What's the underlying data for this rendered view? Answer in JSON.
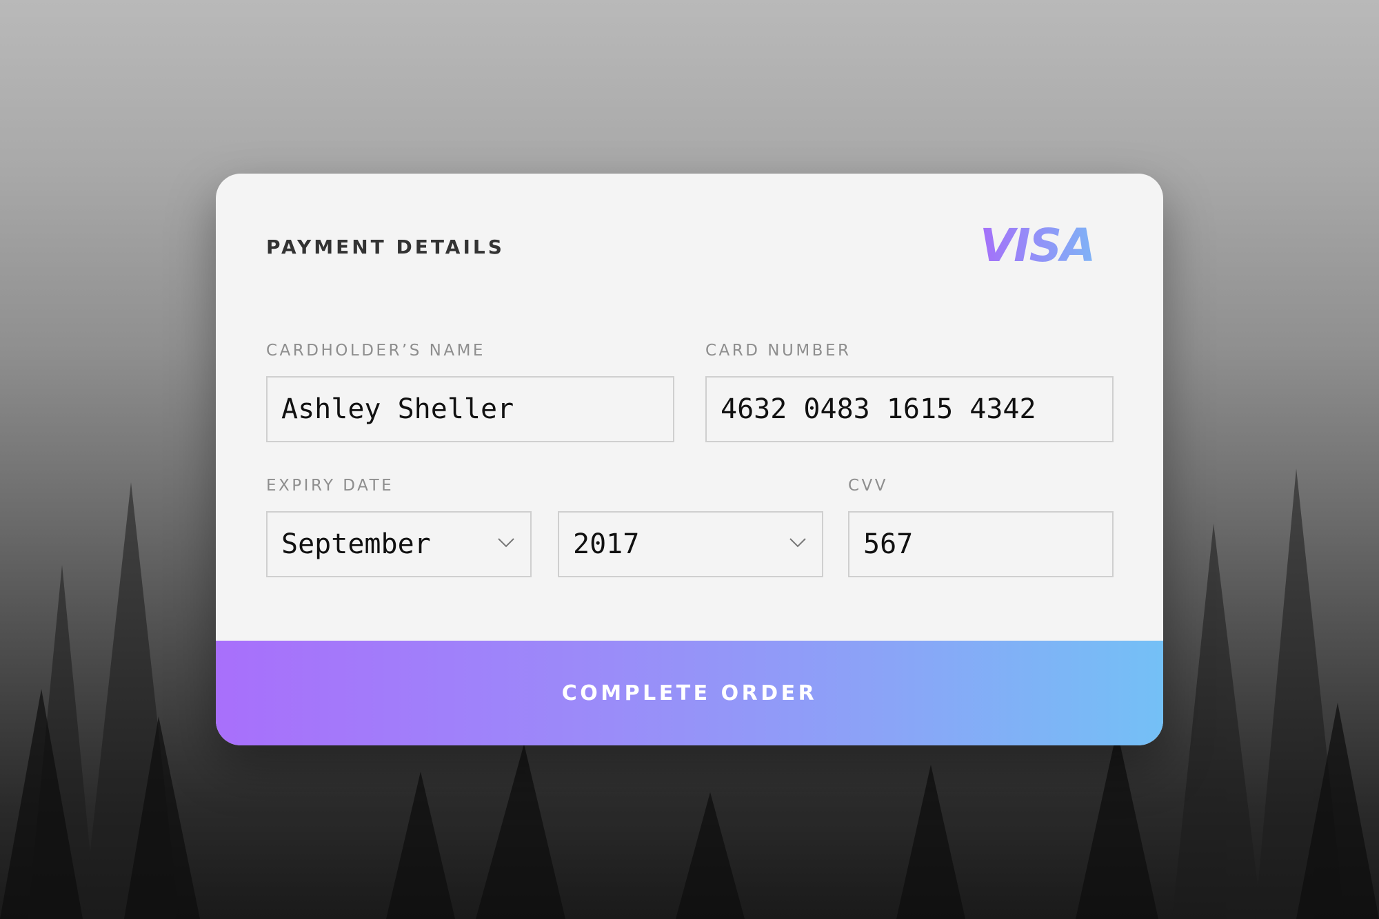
{
  "form": {
    "title": "PAYMENT DETAILS",
    "brand": "VISA",
    "name_label": "CARDHOLDER’S NAME",
    "name_value": "Ashley Sheller",
    "number_label": "CARD NUMBER",
    "number_value": "4632 0483 1615 4342",
    "expiry_label": "EXPIRY DATE",
    "expiry_month": "September",
    "expiry_year": "2017",
    "cvv_label": "CVV",
    "cvv_value": "567",
    "submit_label": "COMPLETE ORDER"
  },
  "colors": {
    "gradient_start": "#a86ffb",
    "gradient_end": "#74c0f6",
    "card_bg": "#f4f4f4",
    "field_border": "#cfcfcf"
  },
  "icons": {
    "month_dropdown": "chevron-down-icon",
    "year_dropdown": "chevron-down-icon"
  }
}
